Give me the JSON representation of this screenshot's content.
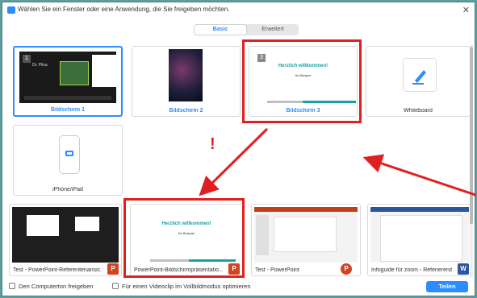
{
  "window": {
    "title": "Wählen Sie ein Fenster oder eine Anwendung, die Sie freigeben möchten."
  },
  "tabs": [
    {
      "label": "Basic",
      "active": true
    },
    {
      "label": "Erweitert",
      "active": false
    }
  ],
  "tiles": {
    "screen1": {
      "label": "Bildschirm 1",
      "badge": "1",
      "presenter": "Dr. Plisa"
    },
    "screen2": {
      "label": "Bildschirm 2"
    },
    "screen3": {
      "label": "Bildschirm 3",
      "badge": "3",
      "slide_title": "Herzlich willkommen!",
      "slide_sub": "für Beispiel"
    },
    "whiteboard": {
      "label": "Whiteboard"
    },
    "iphone": {
      "label": "iPhone/iPad"
    },
    "ppt_speaker": {
      "label": "Test - PowerPoint-Referentenansic..."
    },
    "ppt_show": {
      "label": "PowerPoint-Bildschirmpräsentatio...",
      "slide_title": "Herzlich willkommen!",
      "slide_sub": "für Beispiel"
    },
    "ppt": {
      "label": "Test - PowerPoint"
    },
    "word": {
      "label": "Infoguide für zoom - Referierend..."
    }
  },
  "annotation": {
    "exclamation": "!"
  },
  "footer": {
    "computer_audio": "Den Computerton freigeben",
    "video_clip": "Für einen Videoclip im Vollbildmodus optimieren",
    "share_button": "Teilen"
  },
  "colors": {
    "accent": "#2d8cff",
    "highlight": "#e02020",
    "teal": "#17a2a2"
  }
}
